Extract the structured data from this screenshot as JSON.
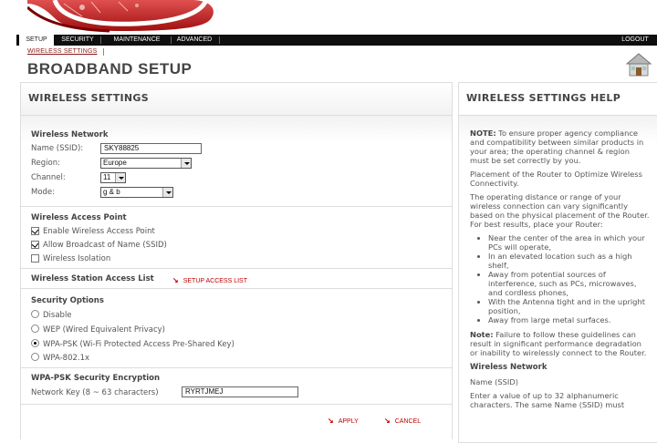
{
  "nav": {
    "tabs": [
      "SETUP",
      "SECURITY",
      "MAINTENANCE",
      "ADVANCED"
    ],
    "logout": "LOGOUT"
  },
  "breadcrumb": "WIRELESS SETTINGS",
  "page_title": "BROADBAND SETUP",
  "left": {
    "title": "WIRELESS SETTINGS",
    "wireless_network": {
      "title": "Wireless Network",
      "ssid_label": "Name (SSID):",
      "ssid_value": "SKY88825",
      "region_label": "Region:",
      "region_value": "Europe",
      "channel_label": "Channel:",
      "channel_value": "11",
      "mode_label": "Mode:",
      "mode_value": "g & b"
    },
    "access_point": {
      "title": "Wireless Access Point",
      "options": [
        {
          "label": "Enable Wireless Access Point",
          "checked": true
        },
        {
          "label": "Allow Broadcast of Name (SSID)",
          "checked": true
        },
        {
          "label": "Wireless Isolation",
          "checked": false
        }
      ]
    },
    "station_list": {
      "title": "Wireless Station Access List",
      "link": "SETUP ACCESS LIST"
    },
    "security": {
      "title": "Security Options",
      "options": [
        {
          "label": "Disable",
          "selected": false
        },
        {
          "label": "WEP (Wired Equivalent Privacy)",
          "selected": false
        },
        {
          "label": "WPA-PSK (Wi-Fi Protected Access Pre-Shared Key)",
          "selected": true
        },
        {
          "label": "WPA-802.1x",
          "selected": false
        }
      ]
    },
    "encryption": {
      "title": "WPA-PSK Security Encryption",
      "key_label": "Network Key (8 ~ 63 characters)",
      "key_value": "RYRTJMEJ"
    },
    "apply": "APPLY",
    "cancel": "CANCEL"
  },
  "help": {
    "title": "WIRELESS SETTINGS HELP",
    "note_label": "NOTE:",
    "note_text": " To ensure proper agency compliance and compatibility between similar products in your area; the operating channel & region must be set correctly by you.",
    "p2": "Placement of the Router to Optimize Wireless Connectivity.",
    "p3": "The operating distance or range of your wireless connection can vary significantly based on the physical placement of the Router. For best results, place your Router:",
    "bullets": [
      "Near the center of the area in which your PCs will operate,",
      "In an elevated location such as a high shelf,",
      "Away from potential sources of interference, such as PCs, microwaves, and cordless phones,",
      "With the Antenna tight and in the upright position,",
      "Away from large metal surfaces."
    ],
    "note2_label": "Note:",
    "note2_text": " Failure to follow these guidelines can result in significant performance degradation or inability to wirelessly connect to the Router.",
    "h_network": "Wireless Network",
    "h_ssid": "Name (SSID)",
    "p_ssid": "Enter a value of up to 32 alphanumeric characters. The same Name (SSID) must"
  },
  "colors": {
    "accent": "#b00000",
    "nav_bg": "#0f0f0f"
  }
}
